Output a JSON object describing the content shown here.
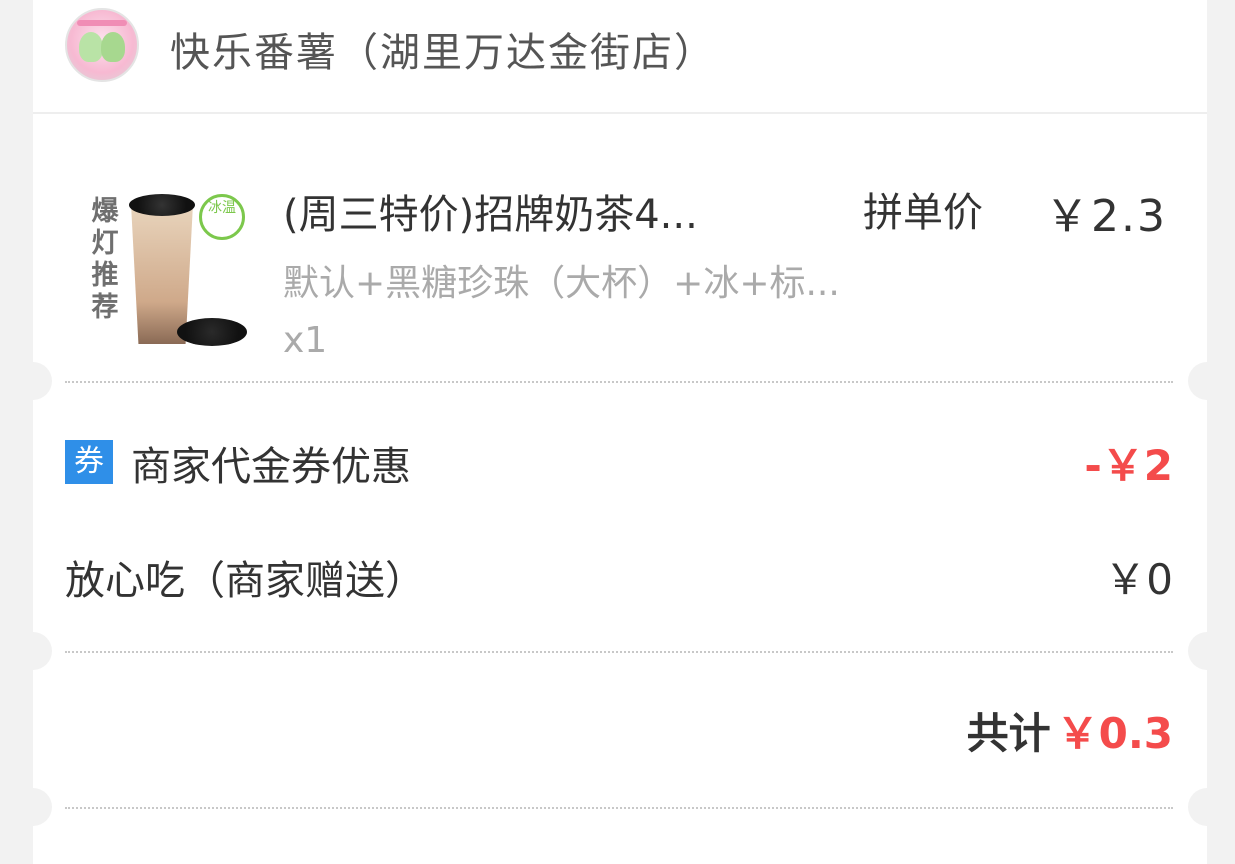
{
  "store": {
    "logo_icon": "store-logo-icon",
    "name": "快乐番薯（湖里万达金街店）"
  },
  "product": {
    "image_tag": "爆灯推荐",
    "badge_text": "冰温",
    "title": "(周三特价)招牌奶茶4...",
    "price_label": "拼单价",
    "price": "￥2.3",
    "spec": "默认+黑糖珍珠（大杯）+冰+标...",
    "quantity": "x1"
  },
  "discounts": {
    "coupon_icon_text": "券",
    "coupon_label": "商家代金券优惠",
    "coupon_value": "-￥2",
    "gift_label": "放心吃（商家赠送）",
    "gift_value": "￥0"
  },
  "total": {
    "label": "共计",
    "value": "￥0.3"
  },
  "colors": {
    "accent_red": "#f44b4b",
    "coupon_blue": "#2f8fe8",
    "badge_green": "#7cc84c"
  }
}
